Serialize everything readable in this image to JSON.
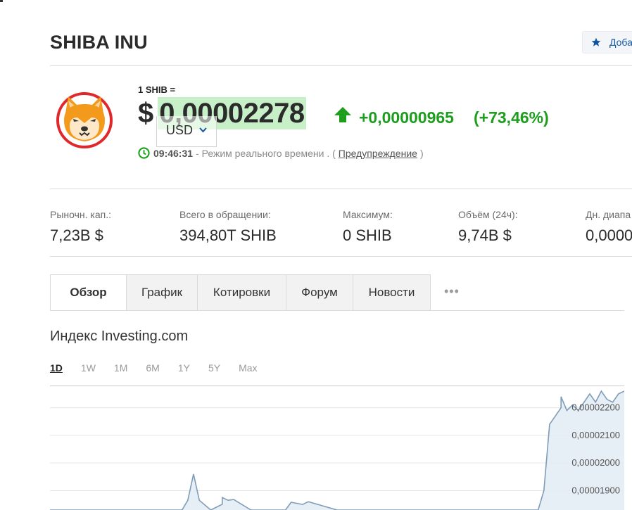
{
  "header": {
    "title": "SHIBA INU",
    "add_button_label": "Доба"
  },
  "quote": {
    "unit_label": "1 SHIB =",
    "currency_symbol": "$",
    "price": "0,00002278",
    "currency": "USD",
    "change_abs": "+0,00000965",
    "change_pct": "(+73,46%)",
    "direction": "up",
    "positive_color": "#1d9e1d",
    "highlight_color": "#c8f0c8"
  },
  "status": {
    "time": "09:46:31",
    "text": "- Режим реального времени . (",
    "link": "Предупреждение",
    "close": ")"
  },
  "stats": [
    {
      "label": "Рыночн. кап.:",
      "value": "7,23B $"
    },
    {
      "label": "Всего в обращении:",
      "value": "394,80T SHIB"
    },
    {
      "label": "Максимум:",
      "value": "0 SHIB"
    },
    {
      "label": "Объём (24ч):",
      "value": "9,74B $"
    },
    {
      "label": "Дн. диапа",
      "value": "0,0000"
    }
  ],
  "tabs": [
    {
      "label": "Обзор",
      "active": true
    },
    {
      "label": "График",
      "active": false
    },
    {
      "label": "Котировки",
      "active": false
    },
    {
      "label": "Форум",
      "active": false
    },
    {
      "label": "Новости",
      "active": false
    }
  ],
  "tabs_more": "•••",
  "section": {
    "title": "Индекс Investing.com",
    "periods": [
      {
        "label": "1D",
        "active": true
      },
      {
        "label": "1W",
        "active": false
      },
      {
        "label": "1M",
        "active": false
      },
      {
        "label": "6M",
        "active": false
      },
      {
        "label": "1Y",
        "active": false
      },
      {
        "label": "5Y",
        "active": false
      },
      {
        "label": "Max",
        "active": false
      }
    ]
  },
  "chart_data": {
    "type": "area",
    "y_ticks": [
      "0,00002200",
      "0,00002100",
      "0,00002000",
      "0,00001900"
    ],
    "y_tick_values": [
      2.2e-05,
      2.1e-05,
      2e-05,
      1.9e-05
    ],
    "ylim": [
      1.83e-05,
      2.26e-05
    ],
    "xlim": [
      0,
      1
    ],
    "series": [
      {
        "x": [
          0,
          0.2,
          0.23,
          0.24,
          0.25,
          0.26,
          0.28,
          0.3,
          0.3,
          0.31,
          0.32,
          0.35,
          0.38,
          0.41,
          0.42,
          0.44,
          0.45,
          0.5,
          0.55,
          0.6,
          0.65,
          0.68,
          0.69,
          0.71,
          0.73,
          0.76,
          0.8,
          0.85,
          0.86,
          0.87,
          0.88,
          0.89,
          0.89,
          0.9,
          0.91,
          0.92,
          0.93,
          0.94,
          0.95,
          0.96,
          0.97,
          0.98,
          0.99,
          1.0
        ],
        "y": [
          1.83e-05,
          1.83e-05,
          1.83e-05,
          1.865e-05,
          1.96e-05,
          1.865e-05,
          1.83e-05,
          1.8505e-05,
          1.875e-05,
          1.865e-05,
          1.868e-05,
          1.83e-05,
          1.83e-05,
          1.83e-05,
          1.858e-05,
          1.85e-05,
          1.86e-05,
          1.83e-05,
          1.83e-05,
          1.83e-05,
          1.83e-05,
          1.83e-05,
          1.83e-05,
          1.83e-05,
          1.83e-05,
          1.83e-05,
          1.83e-05,
          1.83e-05,
          1.9e-05,
          2.14e-05,
          2.17e-05,
          2.2e-05,
          2.24e-05,
          2.19e-05,
          2.21e-05,
          2.19e-05,
          2.22e-05,
          2.25e-05,
          2.22e-05,
          2.26e-05,
          2.23e-05,
          2.22e-05,
          2.25e-05,
          2.26e-05
        ]
      }
    ],
    "line_color": "#7f9cb8",
    "fill_color": "#e3ecf5",
    "grid": true
  }
}
